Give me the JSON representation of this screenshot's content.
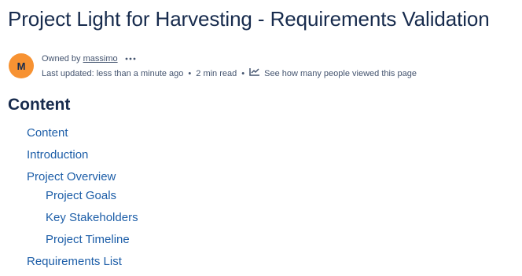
{
  "page": {
    "title": "Project Light for Harvesting - Requirements Validation"
  },
  "byline": {
    "avatar_initial": "M",
    "owned_by_label": "Owned by",
    "owner_name": "massimo",
    "more_icon": "more-horizontal-icon",
    "last_updated": "Last updated: less than a minute ago",
    "read_time": "2 min read",
    "separator": "•",
    "analytics_icon": "line-chart-icon",
    "analytics_label": "See how many people viewed this page"
  },
  "toc": {
    "heading": "Content",
    "items": [
      {
        "label": "Content",
        "level": 1
      },
      {
        "label": "Introduction",
        "level": 1
      },
      {
        "label": "Project Overview",
        "level": 1
      },
      {
        "label": "Project Goals",
        "level": 2
      },
      {
        "label": "Key Stakeholders",
        "level": 2
      },
      {
        "label": "Project Timeline",
        "level": 2
      },
      {
        "label": "Requirements List",
        "level": 1
      }
    ]
  },
  "colors": {
    "link": "#1d5ea8",
    "text": "#172b4d",
    "meta": "#44546f",
    "avatar_bg": "#f79232"
  }
}
